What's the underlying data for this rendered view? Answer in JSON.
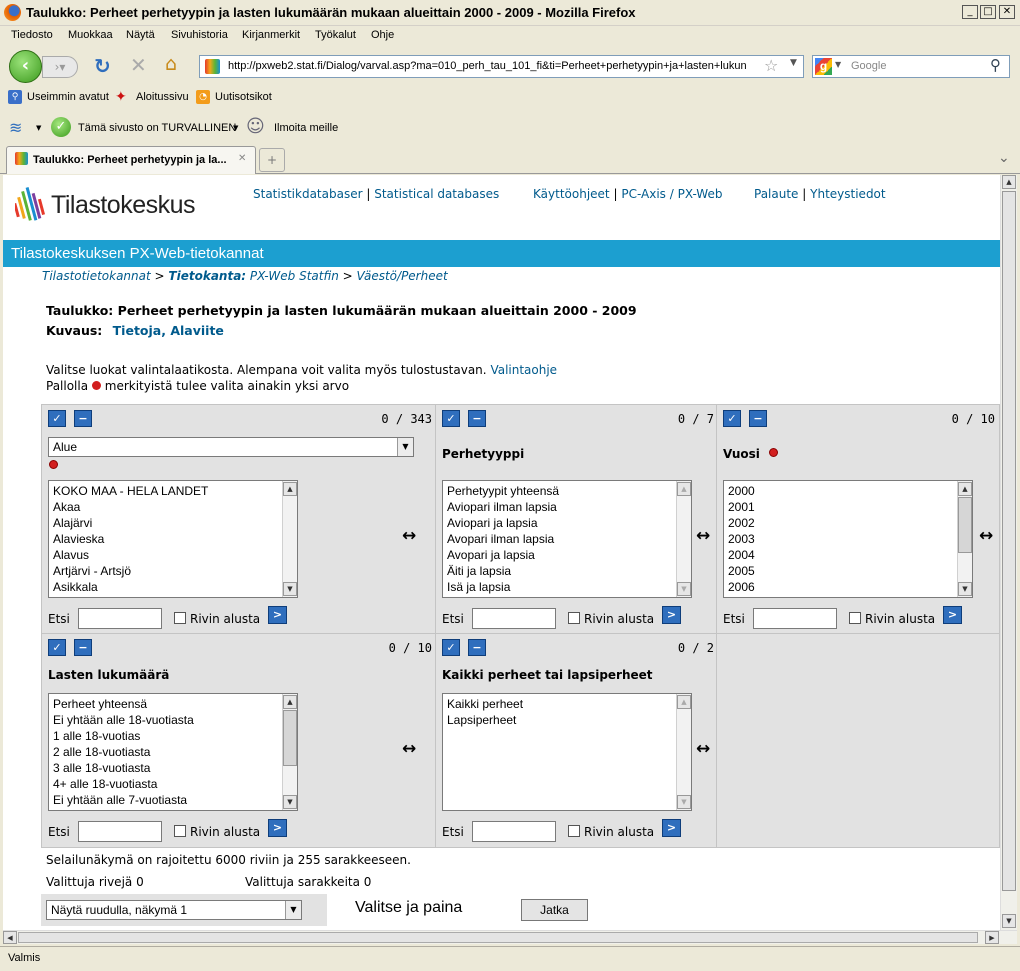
{
  "window": {
    "title": "Taulukko: Perheet perhetyypin ja lasten lukumäärän mukaan alueittain 2000 - 2009 - Mozilla Firefox",
    "minimize": "_",
    "maximize": "□",
    "close": "✕"
  },
  "menubar": [
    "Tiedosto",
    "Muokkaa",
    "Näytä",
    "Sivuhistoria",
    "Kirjanmerkit",
    "Työkalut",
    "Ohje"
  ],
  "navbar": {
    "url": "http://pxweb2.stat.fi/Dialog/varval.asp?ma=010_perh_tau_101_fi&ti=Perheet+perhetyypin+ja+lasten+lukun",
    "search_placeholder": "Google"
  },
  "bookmarks": [
    "Useimmin avatut",
    "Aloitussivu",
    "Uutisotsikot"
  ],
  "toolbar": {
    "safe_text": "Tämä sivusto on TURVALLINEN",
    "report": "Ilmoita meille"
  },
  "tabs": [
    {
      "label": "Taulukko: Perheet perhetyypin ja la..."
    }
  ],
  "site": {
    "logo": "Tilastokeskus",
    "toplinks": {
      "l1": "Statistikdatabaser",
      "sep1": "|",
      "l2": "Statistical databases",
      "l3": "Käyttöohjeet",
      "sep2": "|",
      "l4": "PC-Axis / PX-Web",
      "l5": "Palaute",
      "sep3": "|",
      "l6": "Yhteystiedot"
    },
    "banner": "Tilastokeskuksen PX-Web-tietokannat",
    "breadcrumb": {
      "b1": "Tilastotietokannat",
      "gt1": ">",
      "b2bold": "Tietokanta:",
      "b2": "PX-Web Statfin",
      "gt2": ">",
      "b3": "Väestö/Perheet"
    },
    "table_title": "Taulukko: Perheet perhetyypin ja lasten lukumäärän mukaan alueittain 2000 - 2009",
    "kuvaus_label": "Kuvaus:",
    "kuvaus_l1": "Tietoja",
    "kuvaus_sep": ",",
    "kuvaus_l2": "Alaviite",
    "instr1": "Valitse luokat valintalaatikosta. Alempana voit valita myös tulostustavan.",
    "instr1_link": "Valintaohje",
    "instr2a": "Pallolla",
    "instr2b": "merkityistä tulee valita ainakin yksi arvo"
  },
  "panels": {
    "alue": {
      "count": "0 / 343",
      "select": "Alue",
      "items": [
        "KOKO MAA - HELA LANDET",
        "Akaa",
        "Alajärvi",
        "Alavieska",
        "Alavus",
        "Artjärvi - Artsjö",
        "Asikkala"
      ]
    },
    "perhetyyppi": {
      "count": "0 / 7",
      "title": "Perhetyyppi",
      "items": [
        "Perhetyypit yhteensä",
        "Aviopari ilman lapsia",
        "Aviopari ja lapsia",
        "Avopari ilman lapsia",
        "Avopari ja lapsia",
        "Äiti ja lapsia",
        "Isä ja lapsia"
      ]
    },
    "vuosi": {
      "count": "0 / 10",
      "title": "Vuosi",
      "items": [
        "2000",
        "2001",
        "2002",
        "2003",
        "2004",
        "2005",
        "2006"
      ]
    },
    "lasten": {
      "count": "0 / 10",
      "title": "Lasten lukumäärä",
      "items": [
        "Perheet yhteensä",
        "Ei yhtään alle 18-vuotiasta",
        "1 alle 18-vuotias",
        "2 alle 18-vuotiasta",
        "3 alle 18-vuotiasta",
        "4+ alle 18-vuotiasta",
        "Ei yhtään alle 7-vuotiasta"
      ]
    },
    "kaikki": {
      "count": "0 / 2",
      "title": "Kaikki perheet tai lapsiperheet",
      "items": [
        "Kaikki perheet",
        "Lapsiperheet"
      ]
    }
  },
  "common": {
    "etsi": "Etsi",
    "rivin_alusta": "Rivin alusta",
    "check_glyph": "✓",
    "minus_glyph": "−",
    "go_glyph": ">",
    "arrows": "↔"
  },
  "footer": {
    "limit": "Selailunäkymä on rajoitettu 6000 riviin ja 255 sarakkeeseen.",
    "rows": "Valittuja rivejä 0",
    "cols": "Valittuja sarakkeita 0",
    "view_select": "Näytä ruudulla, näkymä 1",
    "prompt": "Valitse ja paina",
    "go": "Jatka"
  },
  "status": "Valmis"
}
